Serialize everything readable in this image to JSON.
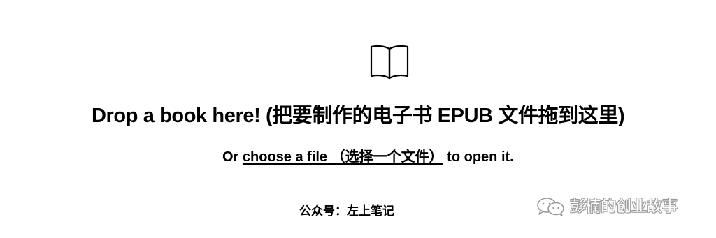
{
  "icon": "open-book-icon",
  "headline": {
    "text": "Drop a book here! (把要制作的电子书 EPUB 文件拖到这里)"
  },
  "subline": {
    "prefix": "Or ",
    "link_text": "choose a file （选择一个文件）",
    "suffix": " to open it."
  },
  "footer": {
    "label": "公众号：左上笔记"
  },
  "watermark": {
    "icon": "wechat-icon",
    "text": "彭楠的创业故事"
  },
  "colors": {
    "background": "#ffffff",
    "text": "#000000",
    "watermark_outline": "#9a9a9a"
  }
}
